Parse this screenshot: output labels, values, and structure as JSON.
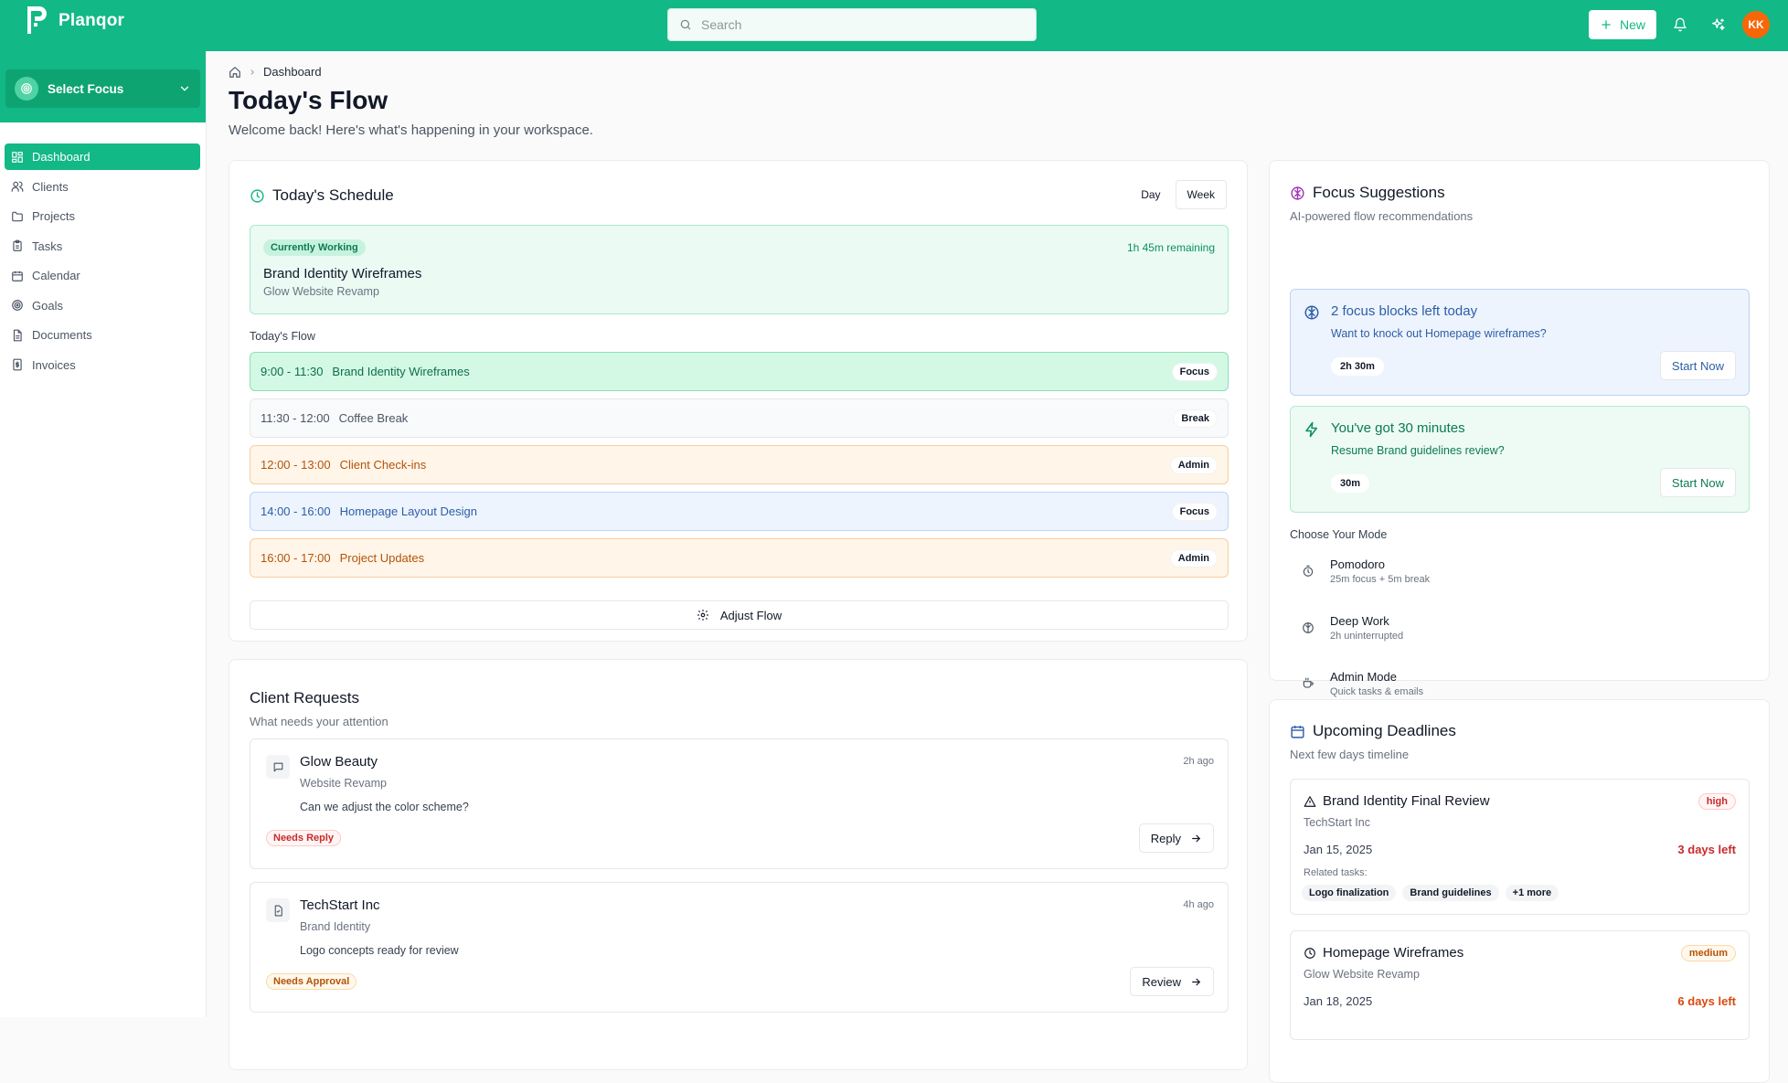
{
  "app": {
    "name": "Planqor"
  },
  "search": {
    "placeholder": "Search"
  },
  "header": {
    "new_label": "New",
    "avatar_initials": "KK"
  },
  "colors": {
    "brand": "#12b886",
    "avatar": "#f76707"
  },
  "sidebar": {
    "focus_select": "Select Focus",
    "items": [
      {
        "label": "Dashboard",
        "icon": "grid-icon"
      },
      {
        "label": "Clients",
        "icon": "users-icon"
      },
      {
        "label": "Projects",
        "icon": "folder-icon"
      },
      {
        "label": "Tasks",
        "icon": "clipboard-icon"
      },
      {
        "label": "Calendar",
        "icon": "calendar-icon"
      },
      {
        "label": "Goals",
        "icon": "target-icon"
      },
      {
        "label": "Documents",
        "icon": "document-icon"
      },
      {
        "label": "Invoices",
        "icon": "receipt-icon"
      }
    ]
  },
  "page": {
    "breadcrumb": "Dashboard",
    "title": "Today's Flow",
    "subtitle": "Welcome back! Here's what's happening in your workspace."
  },
  "schedule": {
    "title": "Today's Schedule",
    "toggle": [
      "Day",
      "Week"
    ],
    "current": {
      "badge": "Currently Working",
      "remaining": "1h 45m remaining",
      "title": "Brand Identity Wireframes",
      "project": "Glow Website Revamp"
    },
    "flow_label": "Today's Flow",
    "slots": [
      {
        "time": "9:00 - 11:30",
        "title": "Brand Identity Wireframes",
        "tag": "Focus"
      },
      {
        "time": "11:30 - 12:00",
        "title": "Coffee Break",
        "tag": "Break"
      },
      {
        "time": "12:00 - 13:00",
        "title": "Client Check-ins",
        "tag": "Admin"
      },
      {
        "time": "14:00 - 16:00",
        "title": "Homepage Layout Design",
        "tag": "Focus"
      },
      {
        "time": "16:00 - 17:00",
        "title": "Project Updates",
        "tag": "Admin"
      }
    ],
    "adjust_label": "Adjust Flow"
  },
  "requests": {
    "title": "Client Requests",
    "subtitle": "What needs your attention",
    "items": [
      {
        "client": "Glow Beauty",
        "project": "Website Revamp",
        "message": "Can we adjust the color scheme?",
        "time": "2h ago",
        "status": "Needs Reply",
        "action": "Reply"
      },
      {
        "client": "TechStart Inc",
        "project": "Brand Identity",
        "message": "Logo concepts ready for review",
        "time": "4h ago",
        "status": "Needs Approval",
        "action": "Review"
      }
    ]
  },
  "suggestions": {
    "title": "Focus Suggestions",
    "subtitle": "AI-powered flow recommendations",
    "cards": [
      {
        "title": "2 focus blocks left today",
        "subtitle": "Want to knock out Homepage wireframes?",
        "duration": "2h 30m",
        "action": "Start Now"
      },
      {
        "title": "You've got 30 minutes",
        "subtitle": "Resume Brand guidelines review?",
        "duration": "30m",
        "action": "Start Now"
      }
    ],
    "mode_label": "Choose Your Mode",
    "modes": [
      {
        "title": "Pomodoro",
        "subtitle": "25m focus + 5m break"
      },
      {
        "title": "Deep Work",
        "subtitle": "2h uninterrupted"
      },
      {
        "title": "Admin Mode",
        "subtitle": "Quick tasks & emails"
      }
    ]
  },
  "deadlines": {
    "title": "Upcoming Deadlines",
    "subtitle": "Next few days timeline",
    "items": [
      {
        "title": "Brand Identity Final Review",
        "client": "TechStart Inc",
        "date": "Jan 15, 2025",
        "left": "3 days left",
        "priority": "high",
        "related_label": "Related tasks:",
        "related": [
          "Logo finalization",
          "Brand guidelines",
          "+1 more"
        ]
      },
      {
        "title": "Homepage Wireframes",
        "client": "Glow Website Revamp",
        "date": "Jan 18, 2025",
        "left": "6 days left",
        "priority": "medium"
      }
    ]
  }
}
